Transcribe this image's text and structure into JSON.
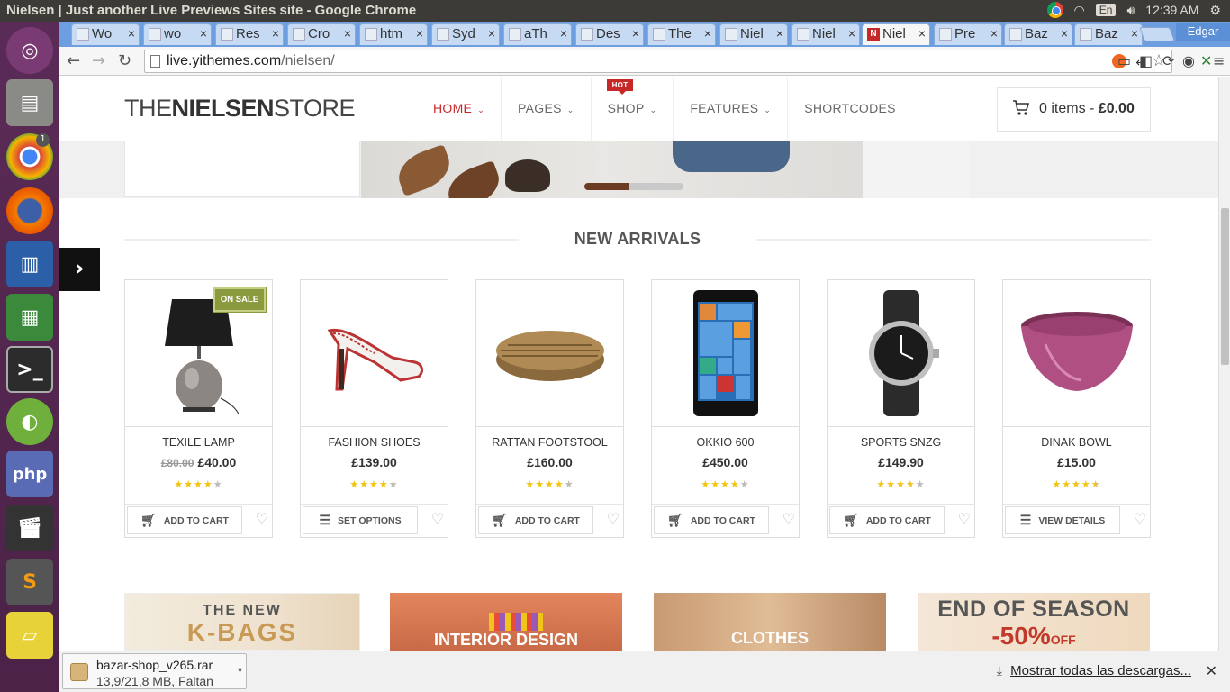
{
  "window": {
    "title": "Nielsen | Just another Live Previews Sites site - Google Chrome"
  },
  "tray": {
    "keyboard": "En",
    "time": "12:39 AM",
    "user": "Edgar"
  },
  "tabs": [
    {
      "label": "Wo"
    },
    {
      "label": "wo"
    },
    {
      "label": "Res"
    },
    {
      "label": "Cro"
    },
    {
      "label": "htm"
    },
    {
      "label": "Syd"
    },
    {
      "label": "aTh"
    },
    {
      "label": "Des"
    },
    {
      "label": "The"
    },
    {
      "label": "Niel"
    },
    {
      "label": "Niel"
    },
    {
      "label": "Niel"
    },
    {
      "label": "Pre"
    },
    {
      "label": "Baz"
    },
    {
      "label": "Baz"
    }
  ],
  "address": {
    "host": "live.yithemes.com",
    "path": "/nielsen/"
  },
  "launcher_badge": "1",
  "site": {
    "logo_light": "THE",
    "logo_bold": "NIELSEN",
    "logo_tail": "STORE",
    "nav": [
      "HOME",
      "PAGES",
      "SHOP",
      "FEATURES",
      "SHORTCODES"
    ],
    "hot_badge": "HOT",
    "cart_count": "0 items -",
    "cart_total": "£0.00"
  },
  "section_title": "NEW ARRIVALS",
  "products": [
    {
      "name": "TEXILE LAMP",
      "old_price": "£80.00",
      "price": "£40.00",
      "rating": 4,
      "cta": "ADD TO CART",
      "sale": "ON SALE"
    },
    {
      "name": "FASHION SHOES",
      "old_price": "",
      "price": "£139.00",
      "rating": 4,
      "cta": "SET OPTIONS",
      "sale": ""
    },
    {
      "name": "RATTAN FOOTSTOOL",
      "old_price": "",
      "price": "£160.00",
      "rating": 4,
      "cta": "ADD TO CART",
      "sale": ""
    },
    {
      "name": "OKKIO 600",
      "old_price": "",
      "price": "£450.00",
      "rating": 4,
      "cta": "ADD TO CART",
      "sale": ""
    },
    {
      "name": "SPORTS SNZG",
      "old_price": "",
      "price": "£149.90",
      "rating": 4,
      "cta": "ADD TO CART",
      "sale": ""
    },
    {
      "name": "DINAK BOWL",
      "old_price": "",
      "price": "£15.00",
      "rating": 4.5,
      "cta": "VIEW DETAILS",
      "sale": ""
    }
  ],
  "promos": [
    {
      "line1": "THE NEW",
      "line2": "K-BAGS"
    },
    {
      "line1": "INTERIOR DESIGN",
      "line2": ""
    },
    {
      "line1": "CLOTHES",
      "line2": ""
    },
    {
      "line1": "END OF SEASON",
      "line2": "-50%"
    }
  ],
  "promo_extra": "OFF",
  "downloads": {
    "file": "bazar-shop_v265.rar",
    "progress": "13,9/21,8 MB, Faltan",
    "show_all": "Mostrar todas las descargas..."
  }
}
